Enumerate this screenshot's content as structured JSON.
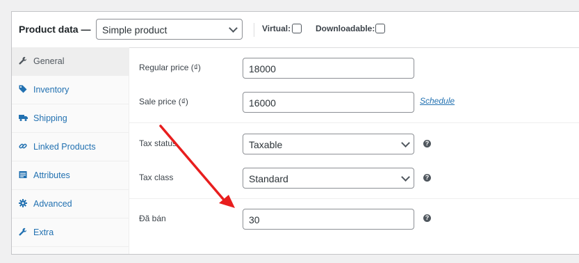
{
  "header": {
    "title": "Product data —",
    "product_type": "Simple product",
    "virtual_label": "Virtual:",
    "downloadable_label": "Downloadable:"
  },
  "sidebar": {
    "items": [
      {
        "label": "General",
        "icon": "wrench-icon",
        "active": true
      },
      {
        "label": "Inventory",
        "icon": "tag-icon",
        "active": false
      },
      {
        "label": "Shipping",
        "icon": "truck-icon",
        "active": false
      },
      {
        "label": "Linked Products",
        "icon": "link-icon",
        "active": false
      },
      {
        "label": "Attributes",
        "icon": "list-icon",
        "active": false
      },
      {
        "label": "Advanced",
        "icon": "gear-icon",
        "active": false
      },
      {
        "label": "Extra",
        "icon": "wrench-icon",
        "active": false
      }
    ]
  },
  "fields": {
    "regular_price": {
      "label": "Regular price (₫)",
      "value": "18000"
    },
    "sale_price": {
      "label": "Sale price (₫)",
      "value": "16000",
      "link": "Schedule"
    },
    "tax_status": {
      "label": "Tax status",
      "value": "Taxable"
    },
    "tax_class": {
      "label": "Tax class",
      "value": "Standard"
    },
    "da_ban": {
      "label": "Đã bán",
      "value": "30"
    }
  },
  "help_glyph": "?",
  "colors": {
    "accent": "#2271b1",
    "annotation_arrow": "#e81e1e"
  }
}
